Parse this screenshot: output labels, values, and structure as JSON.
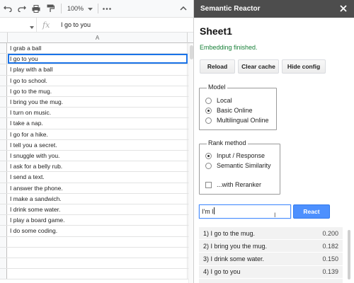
{
  "toolbar": {
    "zoom": "100%",
    "icons": [
      "undo-icon",
      "redo-icon",
      "print-icon",
      "paint-format-icon",
      "more-icon",
      "collapse-icon"
    ]
  },
  "formula_bar": {
    "name_box": "",
    "fx": "fx",
    "value": "I go to you"
  },
  "columns": [
    "A"
  ],
  "rows": [
    "I grab a ball",
    "I go to you",
    "I play with a ball",
    "I go to school.",
    "I go to the mug.",
    "I bring you the mug.",
    "I turn on music.",
    "I take a nap.",
    "I go for a hike.",
    "I tell you a secret.",
    "I snuggle with you.",
    "I ask for a belly rub.",
    "I send a text.",
    "I answer the phone.",
    "I make a sandwich.",
    "I drink some water.",
    "I play a board game.",
    "I do some coding.",
    "",
    "",
    "",
    ""
  ],
  "sidebar": {
    "title": "Semantic Reactor",
    "sheet_name": "Sheet1",
    "status": "Embedding finished.",
    "status_color": "#188038",
    "buttons": {
      "reload": "Reload",
      "clear_cache": "Clear cache",
      "hide_config": "Hide config"
    },
    "model": {
      "legend": "Model",
      "options": [
        "Local",
        "Basic Online",
        "Multilingual Online"
      ],
      "selected": "Basic Online"
    },
    "rank": {
      "legend": "Rank method",
      "options": [
        "Input / Response",
        "Semantic Similarity"
      ],
      "selected": "Input / Response",
      "reranker_label": "...with Reranker"
    },
    "query": "I'm l",
    "react_label": "React",
    "accent": "#4d90fe",
    "results": [
      {
        "label": "1)  I go to the mug.",
        "score": "0.200"
      },
      {
        "label": "2)  I bring you the mug.",
        "score": "0.182"
      },
      {
        "label": "3)  I drink some water.",
        "score": "0.150"
      },
      {
        "label": "4)  I go to you",
        "score": "0.139"
      },
      {
        "label": "",
        "score": ""
      }
    ]
  }
}
